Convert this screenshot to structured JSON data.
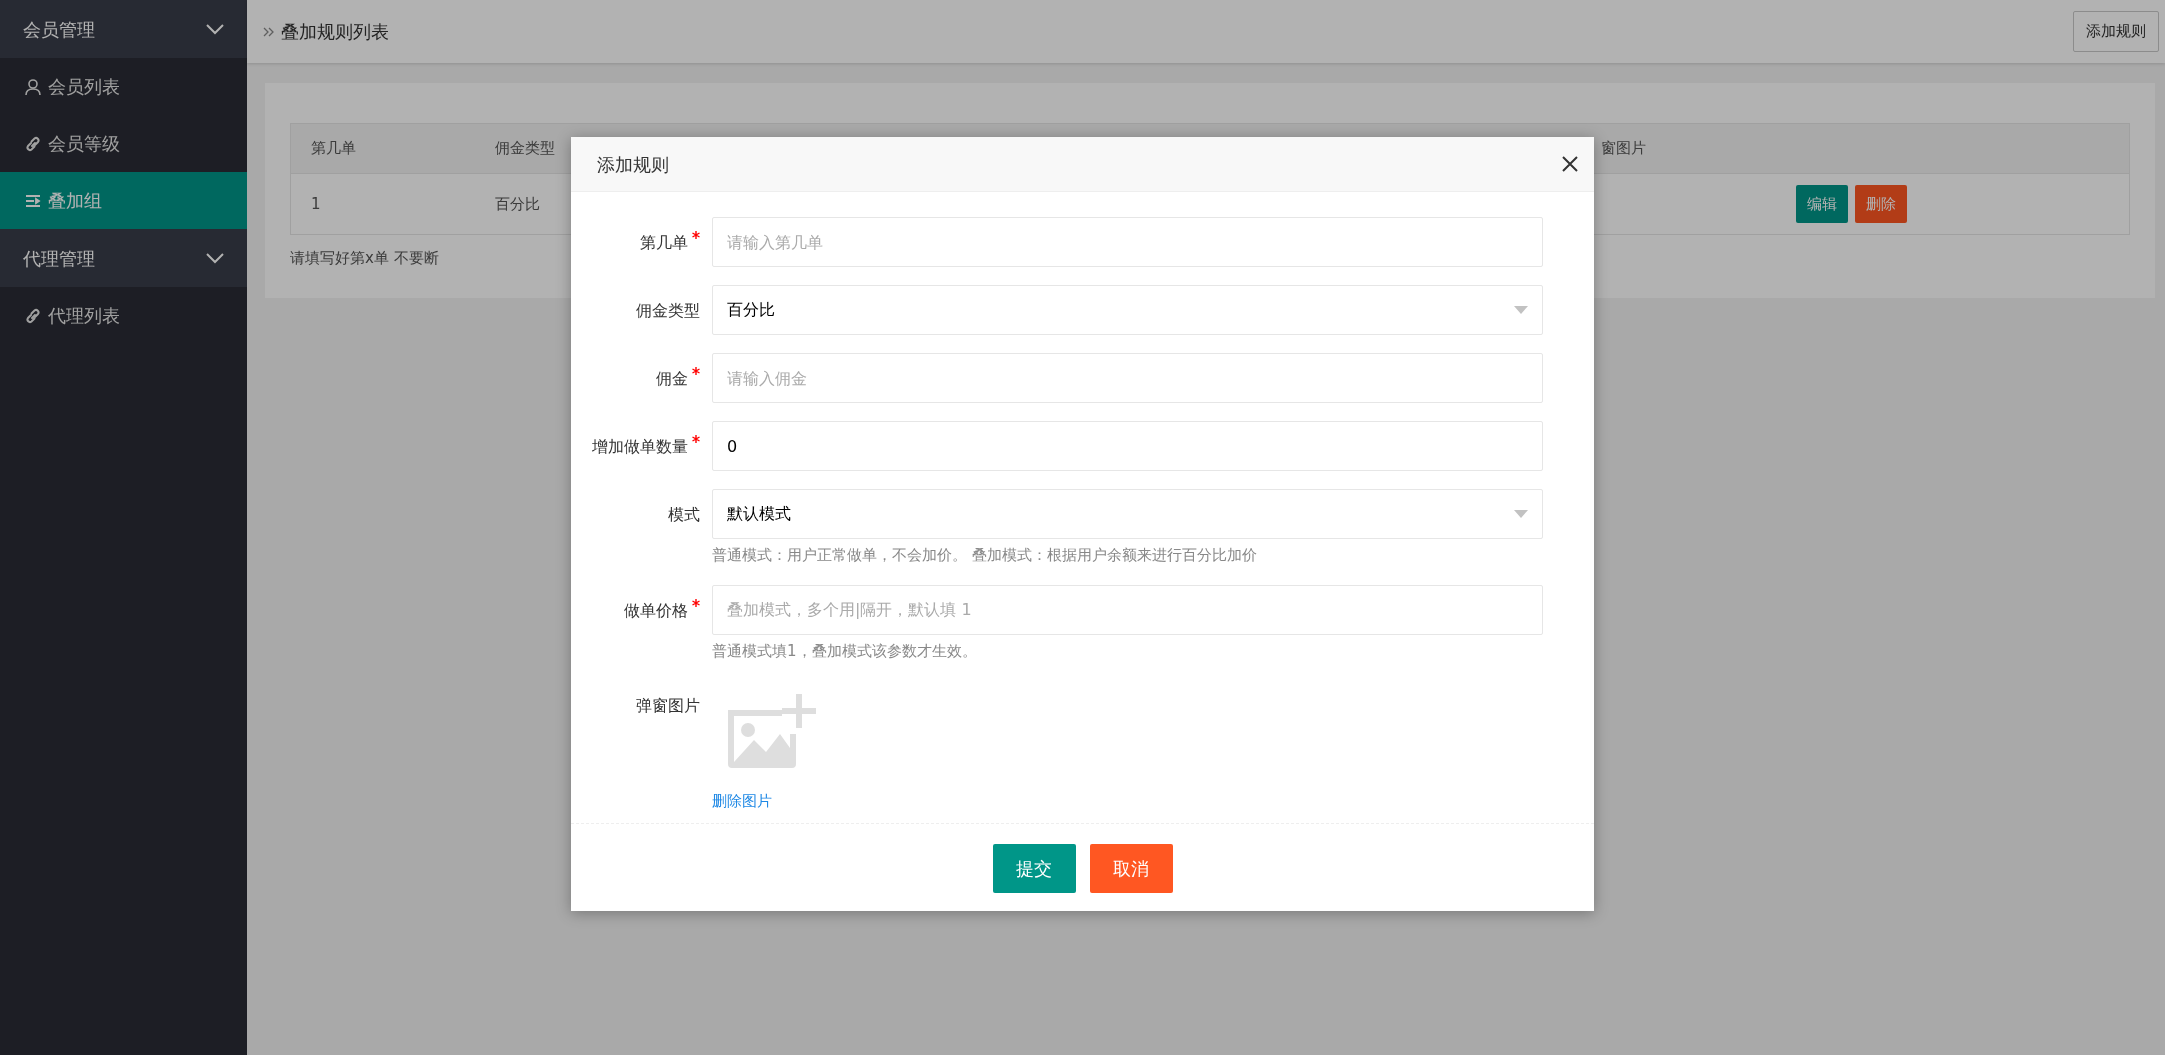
{
  "sidebar": {
    "groups": [
      {
        "label": "会员管理",
        "expanded": true,
        "items": [
          {
            "label": "会员列表",
            "kind": "user",
            "selected": false
          },
          {
            "label": "会员等级",
            "kind": "link",
            "selected": false
          },
          {
            "label": "叠加组",
            "kind": "list",
            "selected": true
          }
        ]
      },
      {
        "label": "代理管理",
        "expanded": true,
        "items": [
          {
            "label": "代理列表",
            "kind": "link",
            "selected": false
          }
        ]
      }
    ]
  },
  "header": {
    "title": "叠加规则列表",
    "button": "添加规则"
  },
  "table": {
    "columns": [
      "第几单",
      "佣金类型",
      "窗图片"
    ],
    "rows": [
      {
        "cells": [
          "1",
          "百分比"
        ],
        "actions": [
          {
            "label": "编辑",
            "kind": "primary"
          },
          {
            "label": "删除",
            "kind": "danger"
          }
        ]
      }
    ]
  },
  "note": "请填写好第x单 不要断",
  "modal": {
    "title": "添加规则",
    "fields": [
      {
        "kind": "input",
        "label": "第几单",
        "required": true,
        "placeholder": "请输入第几单"
      },
      {
        "kind": "select",
        "label": "佣金类型",
        "required": false,
        "value": "百分比"
      },
      {
        "kind": "input",
        "label": "佣金",
        "required": true,
        "placeholder": "请输入佣金"
      },
      {
        "kind": "input",
        "label": "增加做单数量",
        "required": true,
        "value": "0"
      },
      {
        "kind": "select",
        "label": "模式",
        "required": false,
        "value": "默认模式",
        "help": "普通模式：用户正常做单，不会加价。 叠加模式：根据用户余额来进行百分比加价"
      },
      {
        "kind": "input",
        "label": "做单价格",
        "required": true,
        "placeholder": "叠加模式，多个用|隔开，默认填 1",
        "help": "普通模式填1，叠加模式该参数才生效。"
      },
      {
        "kind": "image",
        "label": "弹窗图片",
        "required": false,
        "link": "删除图片"
      }
    ],
    "buttons": [
      {
        "label": "提交",
        "kind": "primary"
      },
      {
        "label": "取消",
        "kind": "danger"
      }
    ]
  }
}
